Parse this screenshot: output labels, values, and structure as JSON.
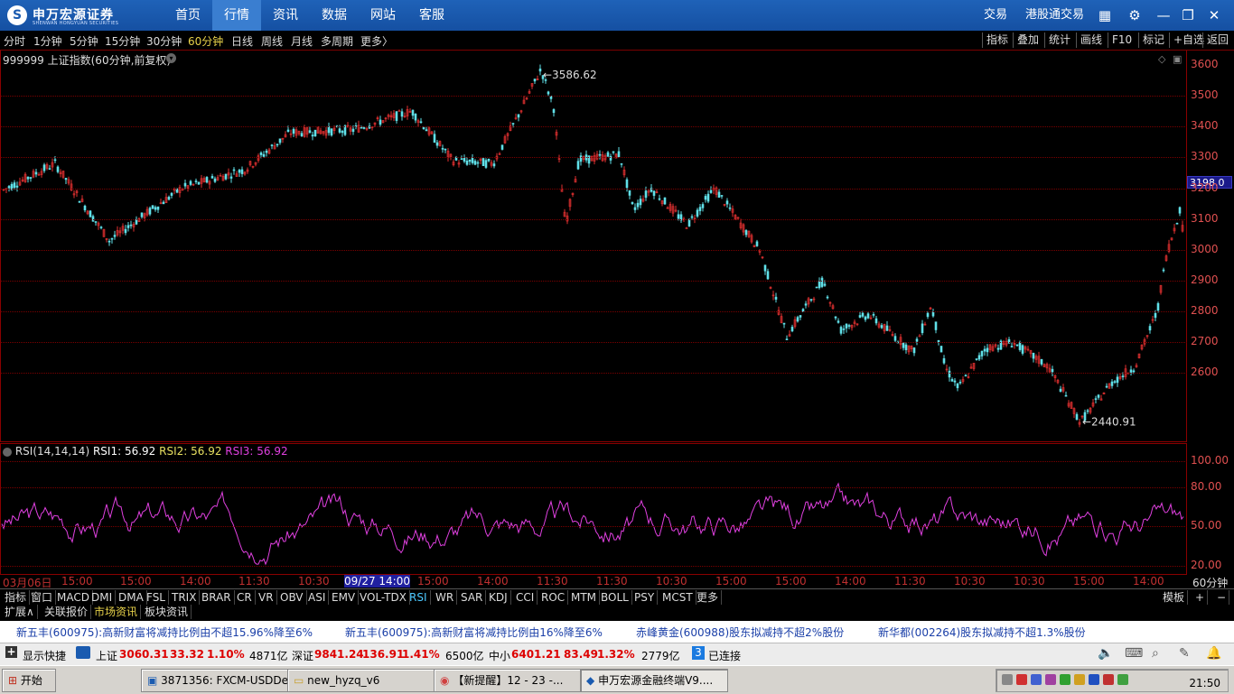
{
  "app": {
    "logo_text": "申万宏源证券",
    "logo_sub": "SHENWAN HONGYUAN SECURITIES",
    "nav": [
      "首页",
      "行情",
      "资讯",
      "数据",
      "网站",
      "客服"
    ],
    "nav_active": 1,
    "right_links": [
      "交易",
      "港股通交易"
    ]
  },
  "periods": {
    "items": [
      "分时",
      "1分钟",
      "5分钟",
      "15分钟",
      "30分钟",
      "60分钟",
      "日线",
      "周线",
      "月线",
      "多周期",
      "更多〉"
    ],
    "active": 5
  },
  "right_buttons": [
    "指标",
    "叠加",
    "统计",
    "画线",
    "F10",
    "标记",
    "+自选",
    "返回"
  ],
  "chart_title": "999999 上证指数(60分钟,前复权)",
  "price_axis": [
    "3600",
    "3500",
    "3400",
    "3300",
    "3200",
    "3100",
    "3000",
    "2900",
    "2800",
    "2700",
    "2600"
  ],
  "current_price_tag": "3198.0",
  "high_label": "3586.62",
  "low_label": "2440.91",
  "rsi_header": {
    "name": "RSI(14,14,14)",
    "rsi1": "RSI1: 56.92",
    "rsi2": "RSI2: 56.92",
    "rsi3": "RSI3: 56.92"
  },
  "rsi_axis": [
    "100.00",
    "80.00",
    "50.00",
    "20.00"
  ],
  "period_label": "60分钟",
  "time_labels": [
    "03月06日",
    "15:00",
    "15:00",
    "14:00",
    "11:30",
    "10:30",
    "09/27 14:00",
    "15:00",
    "14:00",
    "11:30",
    "11:30",
    "10:30",
    "15:00",
    "15:00",
    "14:00",
    "11:30",
    "10:30",
    "10:30",
    "15:00",
    "14:00"
  ],
  "indicators": [
    "指标",
    "窗口",
    "MACD",
    "DMI",
    "DMA",
    "FSL",
    "TRIX",
    "BRAR",
    "CR",
    "VR",
    "OBV",
    "ASI",
    "EMV",
    "VOL-TDX",
    "RSI",
    "WR",
    "SAR",
    "KDJ",
    "CCI",
    "ROC",
    "MTM",
    "BOLL",
    "PSY",
    "MCST",
    "更多"
  ],
  "indicator_active": "RSI",
  "indbar_right": [
    "模板",
    "+",
    "−"
  ],
  "tabs": [
    "扩展∧",
    "关联报价",
    "市场资讯",
    "板块资讯"
  ],
  "tab_active": 2,
  "news": [
    "新五丰(600975):高新财富将减持比例由不超15.96%降至6%",
    "新五丰(600975):高新财富将减持比例由16%降至6%",
    "赤峰黄金(600988)股东拟减持不超2%股份",
    "新华都(002264)股东拟减持不超1.3%股份"
  ],
  "status": {
    "show_shortcut": "显示快捷",
    "sh_label": "上证",
    "sh_value": "3060.31",
    "sh_change": "33.32",
    "sh_pct": "1.10%",
    "sh_amount": "4871亿",
    "sz_label": "深证",
    "sz_value": "9841.24",
    "sz_change": "136.91",
    "sz_pct": "1.41%",
    "sz_amount": "6500亿",
    "zx_label": "中小",
    "zx_value": "6401.21",
    "zx_change": "83.49",
    "zx_pct": "1.32%",
    "zx_amount": "2779亿",
    "conn_count": "3",
    "conn_label": "已连接"
  },
  "taskbar": {
    "start": "开始",
    "tasks": [
      "3871356: FXCM-USDDe...",
      "new_hyzq_v6",
      "【新提醒】12 - 23 -...",
      "申万宏源金融终端V9...."
    ],
    "clock": "21:50"
  },
  "colors": {
    "up": "#e03030",
    "down": "#60e0e8",
    "rsi": "#e040e0",
    "axis": "#e05050"
  }
}
